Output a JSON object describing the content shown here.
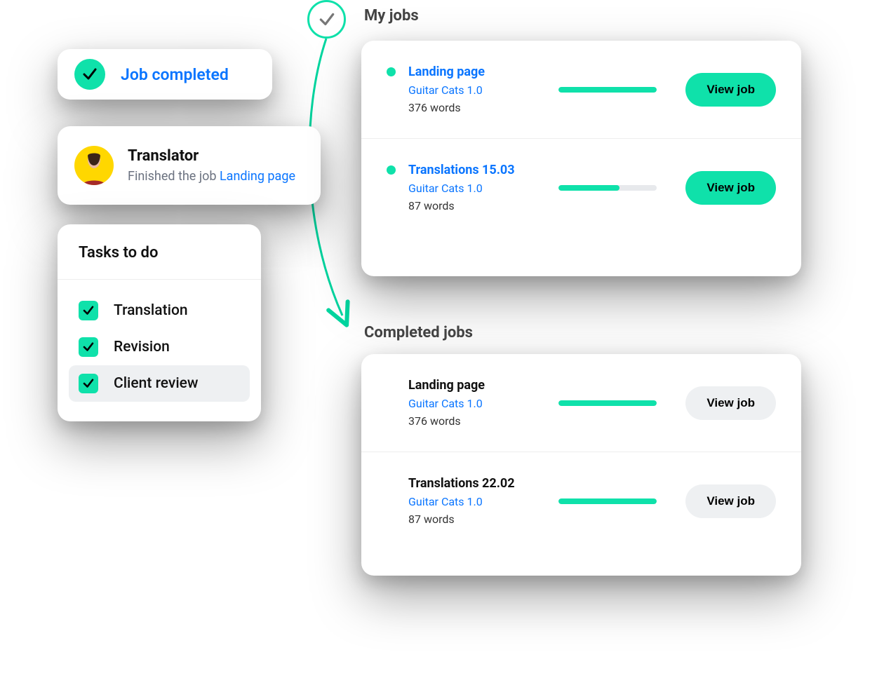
{
  "colors": {
    "accent": "#00d6a0",
    "blue": "#0a75ff"
  },
  "job_completed": {
    "label": "Job completed"
  },
  "translator_card": {
    "role": "Translator",
    "desc_prefix": "Finished the job ",
    "link_text": "Landing page"
  },
  "tasks": {
    "header": "Tasks to do",
    "items": [
      {
        "label": "Translation",
        "checked": true,
        "highlight": false
      },
      {
        "label": "Revision",
        "checked": true,
        "highlight": false
      },
      {
        "label": "Client review",
        "checked": true,
        "highlight": true
      }
    ]
  },
  "sections": {
    "my_jobs": {
      "title": "My jobs",
      "action_label": "View job",
      "action_style": "primary",
      "jobs": [
        {
          "dot": true,
          "title": "Landing page",
          "title_link": true,
          "project": "Guitar Cats 1.0",
          "words": "376 words",
          "progress": 100
        },
        {
          "dot": true,
          "title": "Translations 15.03",
          "title_link": true,
          "project": "Guitar Cats 1.0",
          "words": "87 words",
          "progress": 62
        }
      ]
    },
    "completed": {
      "title": "Completed jobs",
      "action_label": "View job",
      "action_style": "subtle",
      "jobs": [
        {
          "dot": false,
          "title": "Landing page",
          "title_link": false,
          "project": "Guitar Cats 1.0",
          "words": "376 words",
          "progress": 100
        },
        {
          "dot": false,
          "title": "Translations 22.02",
          "title_link": false,
          "project": "Guitar Cats 1.0",
          "words": "87 words",
          "progress": 100
        }
      ]
    }
  }
}
